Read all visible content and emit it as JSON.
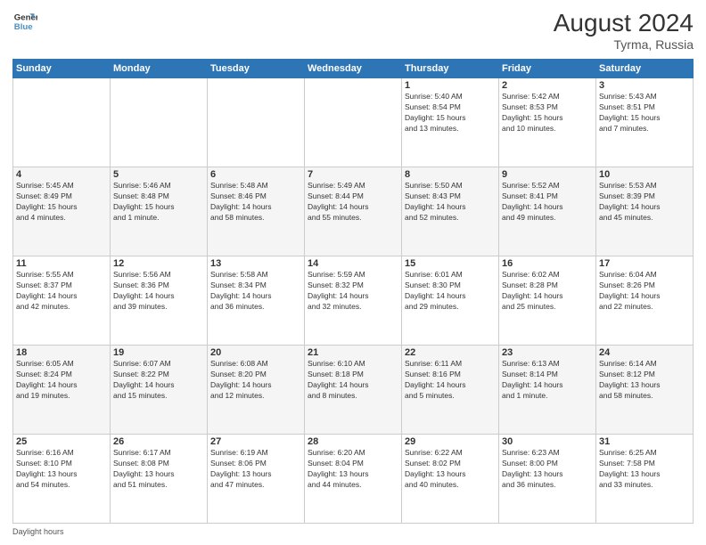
{
  "header": {
    "logo_line1": "General",
    "logo_line2": "Blue",
    "month": "August 2024",
    "location": "Tyrma, Russia"
  },
  "days_of_week": [
    "Sunday",
    "Monday",
    "Tuesday",
    "Wednesday",
    "Thursday",
    "Friday",
    "Saturday"
  ],
  "weeks": [
    [
      {
        "day": "",
        "info": ""
      },
      {
        "day": "",
        "info": ""
      },
      {
        "day": "",
        "info": ""
      },
      {
        "day": "",
        "info": ""
      },
      {
        "day": "1",
        "info": "Sunrise: 5:40 AM\nSunset: 8:54 PM\nDaylight: 15 hours\nand 13 minutes."
      },
      {
        "day": "2",
        "info": "Sunrise: 5:42 AM\nSunset: 8:53 PM\nDaylight: 15 hours\nand 10 minutes."
      },
      {
        "day": "3",
        "info": "Sunrise: 5:43 AM\nSunset: 8:51 PM\nDaylight: 15 hours\nand 7 minutes."
      }
    ],
    [
      {
        "day": "4",
        "info": "Sunrise: 5:45 AM\nSunset: 8:49 PM\nDaylight: 15 hours\nand 4 minutes."
      },
      {
        "day": "5",
        "info": "Sunrise: 5:46 AM\nSunset: 8:48 PM\nDaylight: 15 hours\nand 1 minute."
      },
      {
        "day": "6",
        "info": "Sunrise: 5:48 AM\nSunset: 8:46 PM\nDaylight: 14 hours\nand 58 minutes."
      },
      {
        "day": "7",
        "info": "Sunrise: 5:49 AM\nSunset: 8:44 PM\nDaylight: 14 hours\nand 55 minutes."
      },
      {
        "day": "8",
        "info": "Sunrise: 5:50 AM\nSunset: 8:43 PM\nDaylight: 14 hours\nand 52 minutes."
      },
      {
        "day": "9",
        "info": "Sunrise: 5:52 AM\nSunset: 8:41 PM\nDaylight: 14 hours\nand 49 minutes."
      },
      {
        "day": "10",
        "info": "Sunrise: 5:53 AM\nSunset: 8:39 PM\nDaylight: 14 hours\nand 45 minutes."
      }
    ],
    [
      {
        "day": "11",
        "info": "Sunrise: 5:55 AM\nSunset: 8:37 PM\nDaylight: 14 hours\nand 42 minutes."
      },
      {
        "day": "12",
        "info": "Sunrise: 5:56 AM\nSunset: 8:36 PM\nDaylight: 14 hours\nand 39 minutes."
      },
      {
        "day": "13",
        "info": "Sunrise: 5:58 AM\nSunset: 8:34 PM\nDaylight: 14 hours\nand 36 minutes."
      },
      {
        "day": "14",
        "info": "Sunrise: 5:59 AM\nSunset: 8:32 PM\nDaylight: 14 hours\nand 32 minutes."
      },
      {
        "day": "15",
        "info": "Sunrise: 6:01 AM\nSunset: 8:30 PM\nDaylight: 14 hours\nand 29 minutes."
      },
      {
        "day": "16",
        "info": "Sunrise: 6:02 AM\nSunset: 8:28 PM\nDaylight: 14 hours\nand 25 minutes."
      },
      {
        "day": "17",
        "info": "Sunrise: 6:04 AM\nSunset: 8:26 PM\nDaylight: 14 hours\nand 22 minutes."
      }
    ],
    [
      {
        "day": "18",
        "info": "Sunrise: 6:05 AM\nSunset: 8:24 PM\nDaylight: 14 hours\nand 19 minutes."
      },
      {
        "day": "19",
        "info": "Sunrise: 6:07 AM\nSunset: 8:22 PM\nDaylight: 14 hours\nand 15 minutes."
      },
      {
        "day": "20",
        "info": "Sunrise: 6:08 AM\nSunset: 8:20 PM\nDaylight: 14 hours\nand 12 minutes."
      },
      {
        "day": "21",
        "info": "Sunrise: 6:10 AM\nSunset: 8:18 PM\nDaylight: 14 hours\nand 8 minutes."
      },
      {
        "day": "22",
        "info": "Sunrise: 6:11 AM\nSunset: 8:16 PM\nDaylight: 14 hours\nand 5 minutes."
      },
      {
        "day": "23",
        "info": "Sunrise: 6:13 AM\nSunset: 8:14 PM\nDaylight: 14 hours\nand 1 minute."
      },
      {
        "day": "24",
        "info": "Sunrise: 6:14 AM\nSunset: 8:12 PM\nDaylight: 13 hours\nand 58 minutes."
      }
    ],
    [
      {
        "day": "25",
        "info": "Sunrise: 6:16 AM\nSunset: 8:10 PM\nDaylight: 13 hours\nand 54 minutes."
      },
      {
        "day": "26",
        "info": "Sunrise: 6:17 AM\nSunset: 8:08 PM\nDaylight: 13 hours\nand 51 minutes."
      },
      {
        "day": "27",
        "info": "Sunrise: 6:19 AM\nSunset: 8:06 PM\nDaylight: 13 hours\nand 47 minutes."
      },
      {
        "day": "28",
        "info": "Sunrise: 6:20 AM\nSunset: 8:04 PM\nDaylight: 13 hours\nand 44 minutes."
      },
      {
        "day": "29",
        "info": "Sunrise: 6:22 AM\nSunset: 8:02 PM\nDaylight: 13 hours\nand 40 minutes."
      },
      {
        "day": "30",
        "info": "Sunrise: 6:23 AM\nSunset: 8:00 PM\nDaylight: 13 hours\nand 36 minutes."
      },
      {
        "day": "31",
        "info": "Sunrise: 6:25 AM\nSunset: 7:58 PM\nDaylight: 13 hours\nand 33 minutes."
      }
    ]
  ],
  "footer": "Daylight hours"
}
